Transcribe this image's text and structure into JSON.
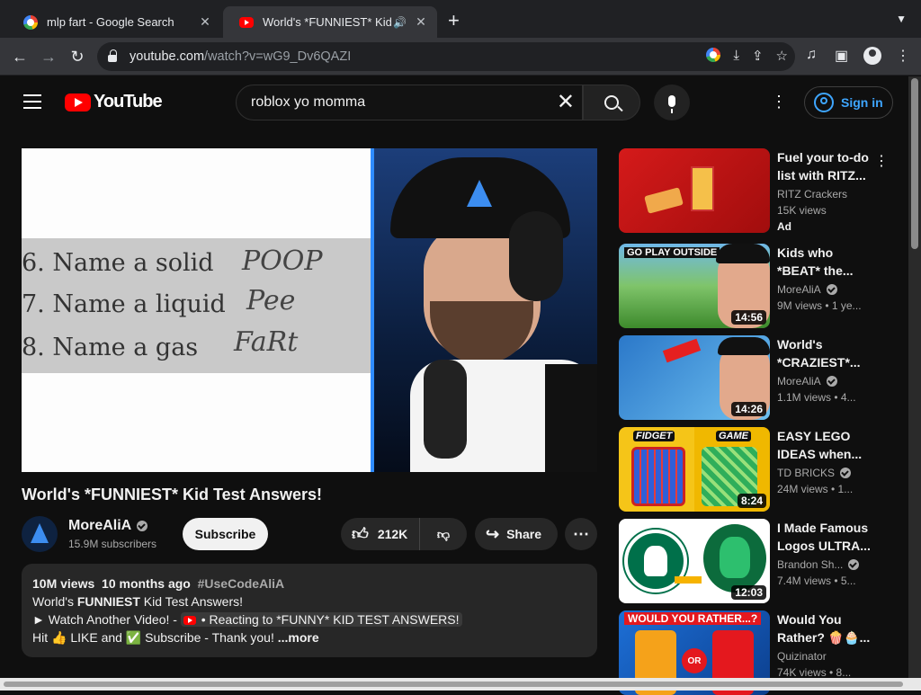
{
  "browser": {
    "tabs": [
      {
        "title": "mlp fart - Google Search",
        "favicon": "google-icon"
      },
      {
        "title": "World's *FUNNIEST* Kid Test Answers! - YouTube",
        "favicon": "youtube-icon",
        "audio": true
      }
    ],
    "url_host": "youtube.com",
    "url_path": "/watch?v=wG9_Dv6QAZI"
  },
  "header": {
    "logo_text": "YouTube",
    "search_value": "roblox yo momma",
    "sign_in_label": "Sign in"
  },
  "player": {
    "paper_lines": [
      "6. Name a solid",
      "7. Name a liquid",
      "8. Name a gas"
    ],
    "paper_answers": [
      "POOP",
      "Pee",
      "FaRt"
    ]
  },
  "video": {
    "title": "World's *FUNNIEST* Kid Test Answers!",
    "channel_name": "MoreAliA",
    "subscribers": "15.9M subscribers",
    "subscribe_label": "Subscribe",
    "likes": "212K",
    "share_label": "Share"
  },
  "description": {
    "views": "10M views",
    "age": "10 months ago",
    "hashtag": "#UseCodeAliA",
    "line1_pre": "World's ",
    "line1_bold": "FUNNIEST",
    "line1_post": " Kid Test Answers!",
    "line2_pre": "► Watch Another Video! - ",
    "line2_chip": " • Reacting to *FUNNY* KID TEST ANSWERS!",
    "line3": "Hit 👍 LIKE and ✅ Subscribe - Thank you!",
    "more": "...more"
  },
  "recommendations": [
    {
      "title": "Fuel your to-do list with RITZ...",
      "channel": "RITZ Crackers",
      "views": "15K views",
      "ad": "Ad",
      "verified": false
    },
    {
      "title": "Kids who *BEAT* the...",
      "channel": "MoreAliA",
      "views": "9M views  •  1 ye...",
      "duration": "14:56",
      "thumb_text": "GO PLAY OUTSIDE",
      "verified": true
    },
    {
      "title": "World's *CRAZIEST*...",
      "channel": "MoreAliA",
      "views": "1.1M views  •  4...",
      "duration": "14:26",
      "verified": true
    },
    {
      "title": "EASY LEGO IDEAS when...",
      "channel": "TD BRICKS",
      "views": "24M views  •  1...",
      "duration": "8:24",
      "thumb_left": "FIDGET",
      "thumb_right": "GAME",
      "verified": true
    },
    {
      "title": "I Made Famous Logos ULTRA...",
      "channel": "Brandon Sh...",
      "views": "7.4M views  •  5...",
      "duration": "12:03",
      "verified": true
    },
    {
      "title": "Would You Rather? 🍿🧁...",
      "channel": "Quizinator",
      "views": "74K views  •  8...",
      "thumb_text": "WOULD YOU RATHER...?",
      "or": "OR",
      "verified": false
    }
  ]
}
